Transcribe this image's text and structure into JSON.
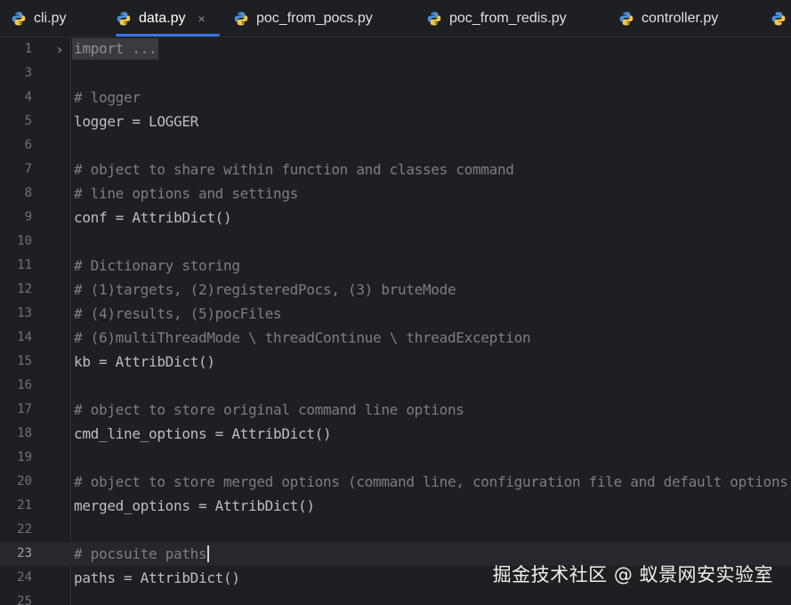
{
  "tabs": [
    {
      "label": "cli.py",
      "icon": "python-icon",
      "active": false
    },
    {
      "label": "data.py",
      "icon": "python-icon",
      "active": true,
      "close": "×"
    },
    {
      "label": "poc_from_pocs.py",
      "icon": "python-icon",
      "active": false
    },
    {
      "label": "poc_from_redis.py",
      "icon": "python-icon",
      "active": false
    },
    {
      "label": "controller.py",
      "icon": "python-icon",
      "active": false
    }
  ],
  "editor": {
    "current_line": 23,
    "lines": [
      {
        "n": "1",
        "text": "import ...",
        "kind": "folded"
      },
      {
        "n": "3",
        "text": "",
        "kind": "code"
      },
      {
        "n": "4",
        "text": "# logger",
        "kind": "comment"
      },
      {
        "n": "5",
        "text": "logger = LOGGER",
        "kind": "code"
      },
      {
        "n": "6",
        "text": "",
        "kind": "code"
      },
      {
        "n": "7",
        "text": "# object to share within function and classes command",
        "kind": "comment"
      },
      {
        "n": "8",
        "text": "# line options and settings",
        "kind": "comment"
      },
      {
        "n": "9",
        "text": "conf = AttribDict()",
        "kind": "code"
      },
      {
        "n": "10",
        "text": "",
        "kind": "code"
      },
      {
        "n": "11",
        "text": "# Dictionary storing",
        "kind": "comment"
      },
      {
        "n": "12",
        "text": "# (1)targets, (2)registeredPocs, (3) bruteMode",
        "kind": "comment"
      },
      {
        "n": "13",
        "text": "# (4)results, (5)pocFiles",
        "kind": "comment"
      },
      {
        "n": "14",
        "text": "# (6)multiThreadMode \\ threadContinue \\ threadException",
        "kind": "comment"
      },
      {
        "n": "15",
        "text": "kb = AttribDict()",
        "kind": "code"
      },
      {
        "n": "16",
        "text": "",
        "kind": "code"
      },
      {
        "n": "17",
        "text": "# object to store original command line options",
        "kind": "comment"
      },
      {
        "n": "18",
        "text": "cmd_line_options = AttribDict()",
        "kind": "code"
      },
      {
        "n": "19",
        "text": "",
        "kind": "code"
      },
      {
        "n": "20",
        "text": "# object to store merged options (command line, configuration file and default options)",
        "kind": "comment"
      },
      {
        "n": "21",
        "text": "merged_options = AttribDict()",
        "kind": "code"
      },
      {
        "n": "22",
        "text": "",
        "kind": "code"
      },
      {
        "n": "23",
        "text": "# pocsuite paths",
        "kind": "comment"
      },
      {
        "n": "24",
        "text": "paths = AttribDict()",
        "kind": "code"
      },
      {
        "n": "25",
        "text": "",
        "kind": "code"
      }
    ]
  },
  "watermark": "掘金技术社区 @ 蚁景网安实验室",
  "colors": {
    "background": "#1e1f22",
    "tab_underline": "#3574f0",
    "comment": "#7a7e85",
    "code": "#bcbec4",
    "line_number": "#6f737a"
  }
}
